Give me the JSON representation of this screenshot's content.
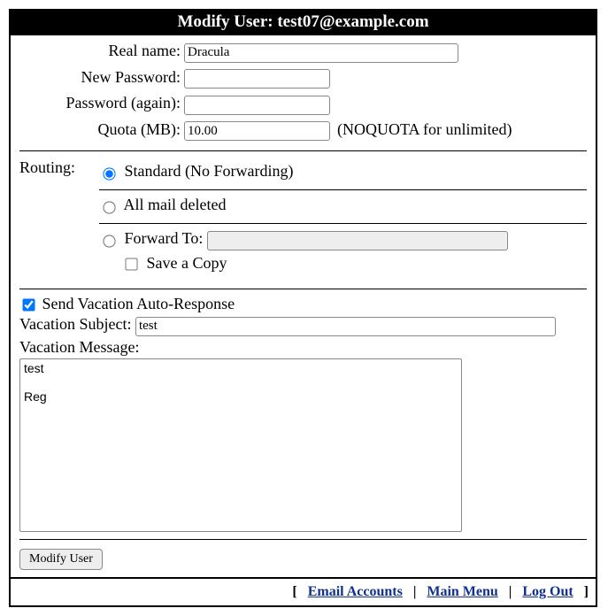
{
  "title": "Modify User: test07@example.com",
  "fields": {
    "real_name_label": "Real name:",
    "real_name_value": "Dracula",
    "new_password_label": "New Password:",
    "new_password_value": "",
    "password_again_label": "Password (again):",
    "password_again_value": "",
    "quota_label": "Quota (MB):",
    "quota_value": "10.00",
    "quota_hint": "(NOQUOTA for unlimited)"
  },
  "routing": {
    "label": "Routing:",
    "standard": "Standard (No Forwarding)",
    "deleted": "All mail deleted",
    "forward_label": "Forward To:",
    "forward_value": "",
    "save_copy": "Save a Copy",
    "selected": "standard",
    "save_copy_checked": false
  },
  "vacation": {
    "send_checked": true,
    "send_label": "Send Vacation Auto-Response",
    "subject_label": "Vacation Subject:",
    "subject_value": "test",
    "message_label": "Vacation Message:",
    "message_value": "test\n\nReg"
  },
  "button": "Modify User",
  "footer": {
    "email_accounts": "Email Accounts",
    "main_menu": "Main Menu",
    "log_out": "Log Out"
  }
}
